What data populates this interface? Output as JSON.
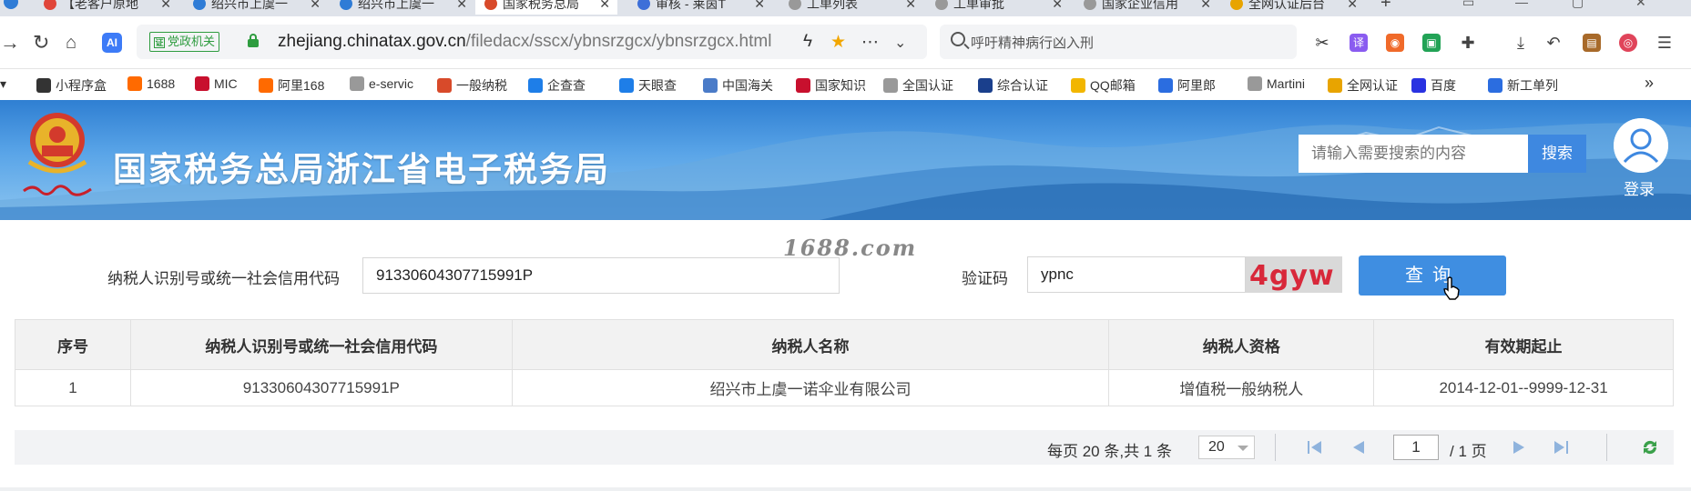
{
  "browser": {
    "tabs": [
      {
        "label": "【老客户原地",
        "color": "#e0463a"
      },
      {
        "label": "绍兴市上虞一",
        "color": "#2f7cd6"
      },
      {
        "label": "绍兴市上虞一",
        "color": "#2f7cd6"
      },
      {
        "label": "国家税务总局",
        "color": "#d84a2a",
        "active": true
      },
      {
        "label": "审核 - 莱茵T",
        "color": "#3d6fd8"
      },
      {
        "label": "工单列表",
        "color": "#999999"
      },
      {
        "label": "工单审批",
        "color": "#999999"
      },
      {
        "label": "国家企业信用",
        "color": "#999999"
      },
      {
        "label": "全网认证后台",
        "color": "#e8a400"
      }
    ],
    "tab_close": "✕",
    "new_tab": "+",
    "ai_badge": "AI",
    "gov_badge": "党政机关",
    "gov_badge_icon": "证",
    "url_host": "zhejiang.chinatax.gov.cn",
    "url_path": "/filedacx/sscx/ybnsrzgcx/ybnsrzgcx.html",
    "search_text": "呼吁精神病行凶入刑",
    "bookmarks": [
      {
        "label": "小程序盒",
        "color": "#333333"
      },
      {
        "label": "1688",
        "color": "#ff6a00"
      },
      {
        "label": "MIC",
        "color": "#c8102e"
      },
      {
        "label": "阿里168",
        "color": "#ff6a00"
      },
      {
        "label": "e-servic",
        "color": "#999999"
      },
      {
        "label": "一般纳税",
        "color": "#d84a2a"
      },
      {
        "label": "企查查",
        "color": "#1e7ee8"
      },
      {
        "label": "天眼查",
        "color": "#1e7ee8"
      },
      {
        "label": "中国海关",
        "color": "#4a7bc8"
      },
      {
        "label": "国家知识",
        "color": "#c8102e"
      },
      {
        "label": "全国认证",
        "color": "#999999"
      },
      {
        "label": "综合认证",
        "color": "#1a3f8c"
      },
      {
        "label": "QQ邮箱",
        "color": "#f2b600"
      },
      {
        "label": "阿里郎",
        "color": "#2b6de0"
      },
      {
        "label": "Martini",
        "color": "#999999"
      },
      {
        "label": "全网认证",
        "color": "#e8a400"
      },
      {
        "label": "百度",
        "color": "#2932e1"
      },
      {
        "label": "新工单列",
        "color": "#2b6de0"
      }
    ],
    "bookmarks_more": "»"
  },
  "site": {
    "title": "国家税务总局浙江省电子税务局",
    "search_placeholder": "请输入需要搜索的内容",
    "search_button": "搜索",
    "login_label": "登录"
  },
  "form": {
    "watermark": "1688.com",
    "id_label": "纳税人识别号或统一社会信用代码",
    "id_value": "91330604307715991P",
    "captcha_label": "验证码",
    "captcha_value": "ypnc",
    "captcha_image_text": "4gyw",
    "query_button": "查询"
  },
  "table": {
    "headers": [
      "序号",
      "纳税人识别号或统一社会信用代码",
      "纳税人名称",
      "纳税人资格",
      "有效期起止"
    ],
    "rows": [
      [
        "1",
        "91330604307715991P",
        "绍兴市上虞一诺伞业有限公司",
        "增值税一般纳税人",
        "2014-12-01--9999-12-31"
      ]
    ]
  },
  "pager": {
    "summary": "每页 20 条,共 1 条",
    "page_size": "20",
    "current_page": "1",
    "page_count": "/ 1 页"
  },
  "colors": {
    "header_blue": "#2f7fd2",
    "button_blue": "#3f8ee1",
    "captcha_red": "#d8283a",
    "gov_green": "#2e9c3f"
  }
}
